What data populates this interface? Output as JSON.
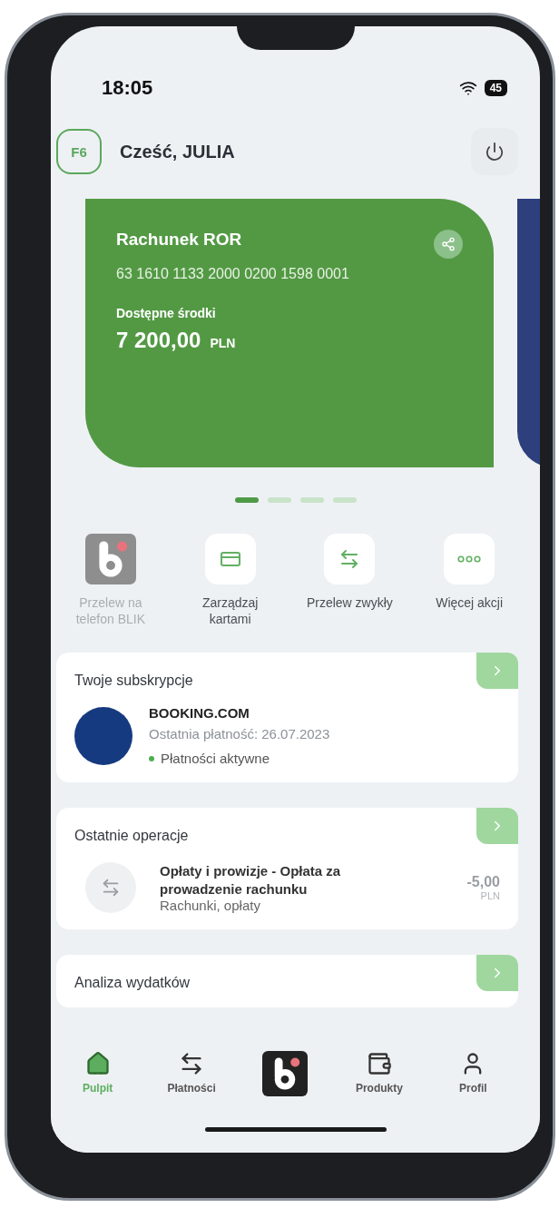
{
  "status_bar": {
    "time": "18:05",
    "battery": "45"
  },
  "header": {
    "badge": "F6",
    "greeting": "Cześć, JULIA"
  },
  "account_card": {
    "name": "Rachunek ROR",
    "number": "63 1610 1133 2000 0200 1598 0001",
    "balance_label": "Dostępne środki",
    "balance": "7 200,00",
    "currency": "PLN"
  },
  "pager": [
    {
      "selected": true
    },
    {
      "selected": false
    },
    {
      "selected": false
    },
    {
      "selected": false
    }
  ],
  "actions": [
    {
      "kind": "blik",
      "label": "Przelew na telefon BLIK",
      "disabled": true
    },
    {
      "kind": "standard",
      "label": "Zarządzaj kartami",
      "disabled": false
    },
    {
      "kind": "standard",
      "label": "Przelew zwykły",
      "disabled": false
    },
    {
      "kind": "standard",
      "label": "Więcej akcji",
      "disabled": false
    }
  ],
  "subscriptions": {
    "title": "Twoje subskrypcje",
    "name": "BOOKING.COM",
    "last_payment": "Ostatnia płatność: 26.07.2023",
    "status": "Płatności aktywne"
  },
  "operations": {
    "title": "Ostatnie operacje",
    "name": "Opłaty i prowizje - Opłata za prowadzenie rachunku",
    "category": "Rachunki, opłaty",
    "amount": "-5,00",
    "currency": "PLN"
  },
  "analysis": {
    "title": "Analiza wydatków"
  },
  "nav": [
    {
      "kind": "tab",
      "label": "Pulpit",
      "selected": true
    },
    {
      "kind": "tab",
      "label": "Płatności",
      "selected": false
    },
    {
      "kind": "blik",
      "selected": false
    },
    {
      "kind": "tab",
      "label": "Produkty",
      "selected": false
    },
    {
      "kind": "tab",
      "label": "Profil",
      "selected": false
    }
  ]
}
